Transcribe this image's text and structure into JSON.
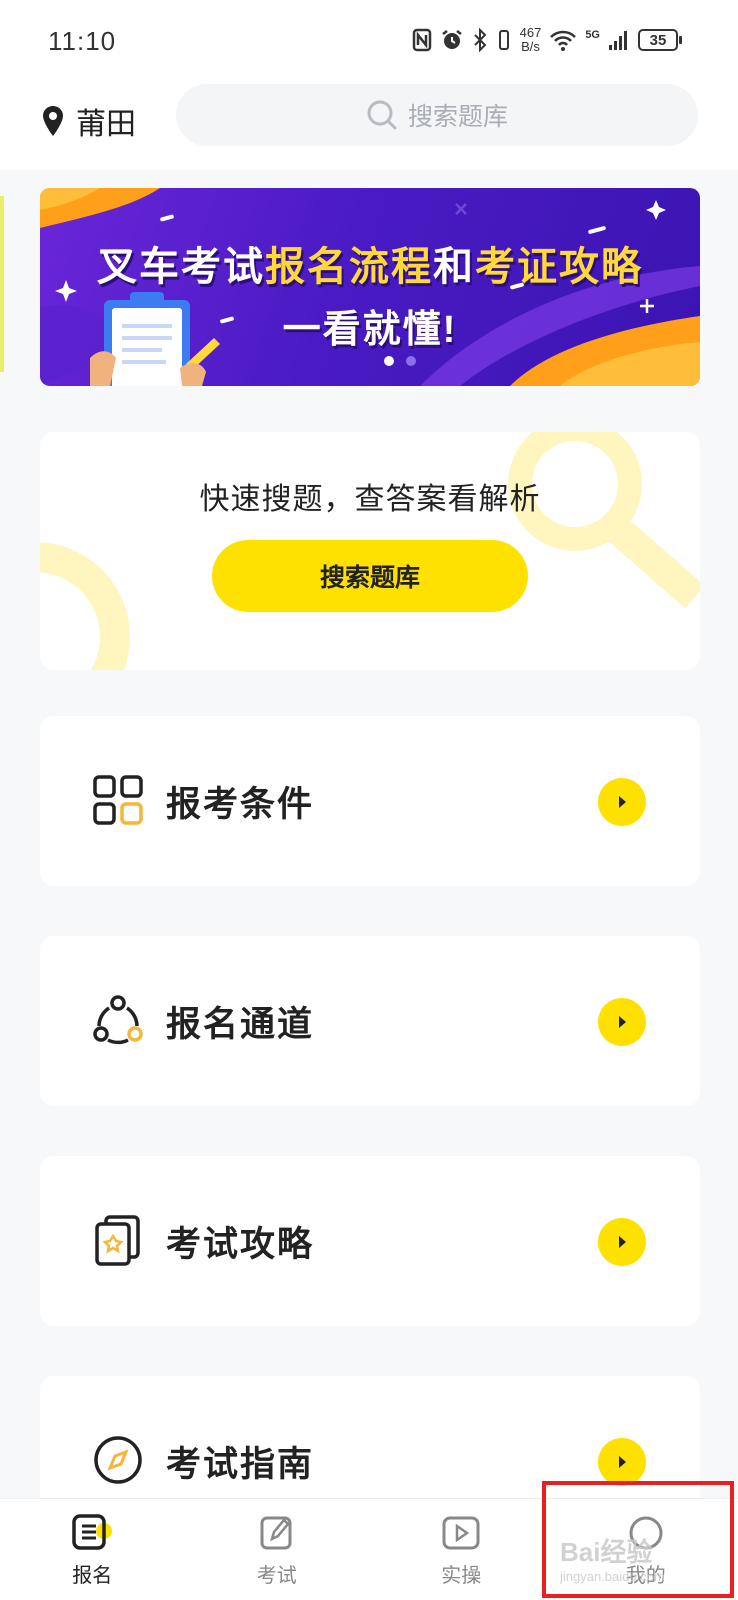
{
  "status_bar": {
    "time": "11:10",
    "net_speed_value": "467",
    "net_speed_unit": "B/s",
    "network": "5G",
    "battery": "35"
  },
  "header": {
    "location": "莆田",
    "search_placeholder": "搜索题库"
  },
  "banner": {
    "line1_part1": "叉车考试",
    "line1_highlight1": "报名流程",
    "line1_part2": "和",
    "line1_highlight2": "考证攻略",
    "line2": "一看就懂!"
  },
  "quick_search": {
    "title": "快速搜题，查答案看解析",
    "button_label": "搜索题库"
  },
  "menu": {
    "items": [
      {
        "label": "报考条件",
        "icon": "grid-icon"
      },
      {
        "label": "报名通道",
        "icon": "network-icon"
      },
      {
        "label": "考试攻略",
        "icon": "cards-icon"
      },
      {
        "label": "考试指南",
        "icon": "compass-icon"
      }
    ]
  },
  "bottom_nav": {
    "items": [
      {
        "label": "报名",
        "icon": "list-icon",
        "active": true
      },
      {
        "label": "考试",
        "icon": "edit-icon",
        "active": false
      },
      {
        "label": "实操",
        "icon": "play-icon",
        "active": false
      },
      {
        "label": "我的",
        "icon": "profile-icon",
        "active": false
      }
    ]
  },
  "watermark": {
    "text": "Bai经验",
    "subtext": "jingyan.baidu.com"
  },
  "colors": {
    "accent": "#ffe100",
    "banner_purple": "#4a1bc4",
    "highlight_red": "#e82020"
  }
}
